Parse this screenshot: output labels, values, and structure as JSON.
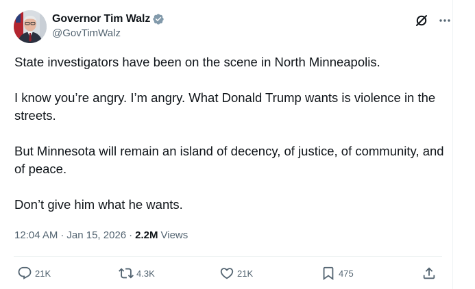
{
  "author": {
    "display_name": "Governor Tim Walz",
    "handle": "@GovTimWalz",
    "verified": true,
    "verified_color": "#829aab"
  },
  "tweet": {
    "paragraphs": [
      "State investigators have been on the scene in North Minneapolis.",
      "I know you’re angry. I’m angry. What Donald Trump wants is violence in the streets.",
      "But Minnesota will remain an island of decency, of justice, of community, and of peace.",
      "Don’t give him what he wants."
    ]
  },
  "meta": {
    "time": "12:04 AM",
    "date": "Jan 15, 2026",
    "separator": "·",
    "views_count": "2.2M",
    "views_label": "Views"
  },
  "actions": {
    "replies": "21K",
    "reposts": "4.3K",
    "likes": "21K",
    "bookmarks": "475"
  },
  "icons": {
    "header": [
      "grok-icon",
      "more-icon"
    ],
    "actions": [
      "reply-icon",
      "repost-icon",
      "like-icon",
      "bookmark-icon",
      "share-icon"
    ]
  },
  "colors": {
    "text": "#0f1419",
    "secondary": "#536471",
    "divider": "#eff3f4"
  }
}
